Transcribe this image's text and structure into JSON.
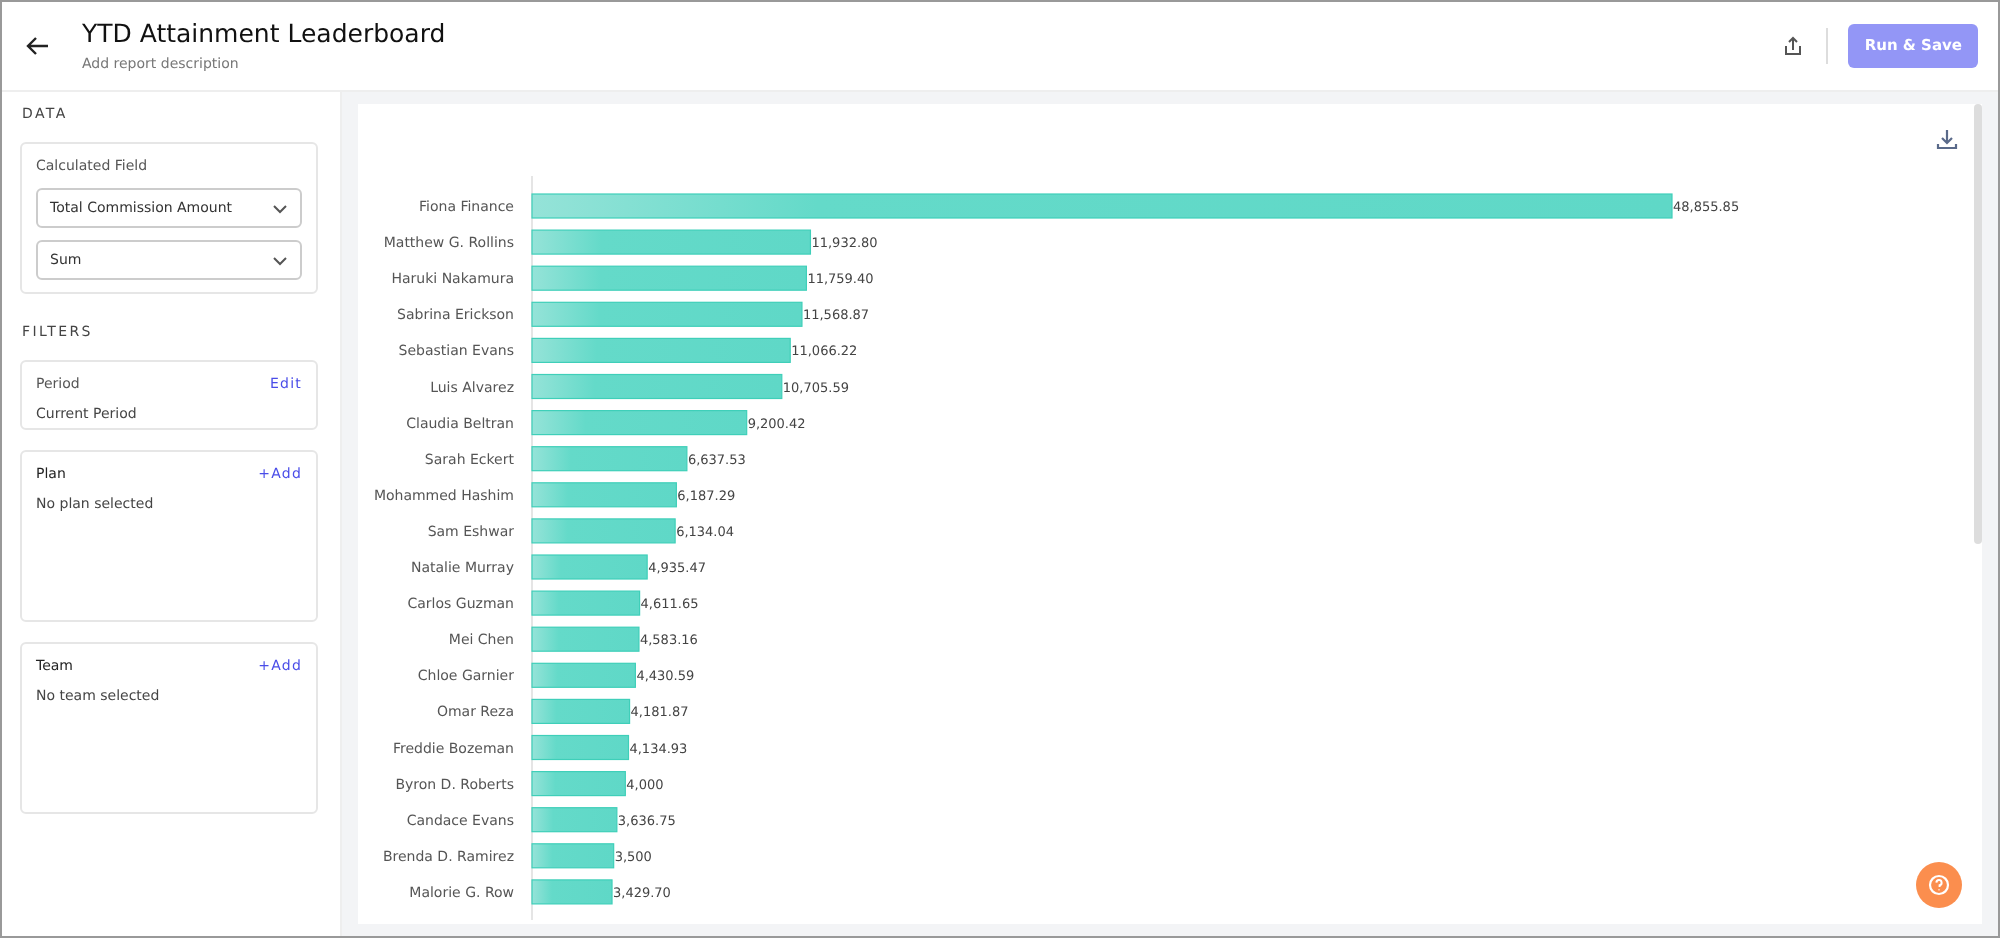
{
  "header": {
    "title": "YTD Attainment Leaderboard",
    "description_placeholder": "Add report description",
    "run_button": "Run & Save"
  },
  "sidebar": {
    "data_heading": "DATA",
    "calculated_field": {
      "label": "Calculated Field",
      "field": "Total Commission Amount",
      "aggregation": "Sum"
    },
    "filters_heading": "FILTERS",
    "filters": [
      {
        "kind": "period",
        "label": "Period",
        "action": "Edit",
        "value": "Current Period"
      },
      {
        "kind": "list",
        "label": "Plan",
        "action": "+Add",
        "value": "No plan selected"
      },
      {
        "kind": "list",
        "label": "Team",
        "action": "+Add",
        "value": "No team selected"
      }
    ]
  },
  "chart": {
    "chart_data": {
      "type": "bar",
      "orientation": "horizontal",
      "categories": [
        "Fiona Finance",
        "Matthew G. Rollins",
        "Haruki Nakamura",
        "Sabrina Erickson",
        "Sebastian Evans",
        "Luis Alvarez",
        "Claudia Beltran",
        "Sarah Eckert",
        "Mohammed Hashim",
        "Sam Eshwar",
        "Natalie Murray",
        "Carlos Guzman",
        "Mei Chen",
        "Chloe Garnier",
        "Omar Reza",
        "Freddie Bozeman",
        "Byron D. Roberts",
        "Candace Evans",
        "Brenda D. Ramirez",
        "Malorie G. Row"
      ],
      "values": [
        48855.85,
        11932.8,
        11759.4,
        11568.87,
        11066.22,
        10705.59,
        9200.42,
        6637.53,
        6187.29,
        6134.04,
        4935.47,
        4611.65,
        4583.16,
        4430.59,
        4181.87,
        4134.93,
        4000,
        3636.75,
        3500,
        3429.7
      ],
      "value_labels": [
        "48,855.85",
        "11,932.80",
        "11,759.40",
        "11,568.87",
        "11,066.22",
        "10,705.59",
        "9,200.42",
        "6,637.53",
        "6,187.29",
        "6,134.04",
        "4,935.47",
        "4,611.65",
        "4,583.16",
        "4,430.59",
        "4,181.87",
        "4,134.93",
        "4,000",
        "3,636.75",
        "3,500",
        "3,429.70"
      ]
    }
  }
}
